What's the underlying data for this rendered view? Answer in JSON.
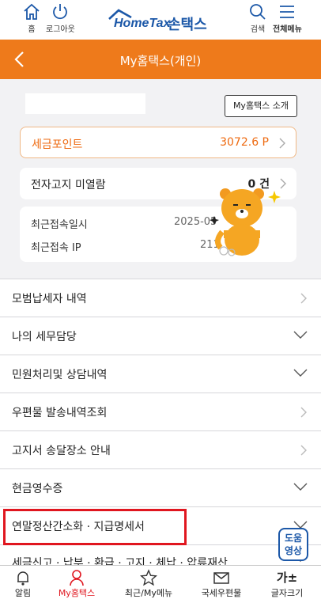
{
  "topbar": {
    "home_label": "홈",
    "logout_label": "로그아웃",
    "logo_text": "HomeTax",
    "logo_korean": "손택스",
    "search_label": "검색",
    "menu_label": "전체메뉴"
  },
  "header": {
    "title": "My홈택스(개인)"
  },
  "profile": {
    "intro_button": "My홈택스 소개",
    "tax_point_label": "세금포인트",
    "tax_point_value": "3072.6 P",
    "notice_label": "전자고지 미열람",
    "notice_value": "0 건",
    "last_login_label": "최근접속일시",
    "last_login_value": "2025-05",
    "last_ip_label": "최근접속 IP",
    "last_ip_value": "211"
  },
  "menu": {
    "items": [
      {
        "label": "모범납세자 내역",
        "chevron": "right"
      },
      {
        "label": "나의 세무담당",
        "chevron": "down"
      },
      {
        "label": "민원처리및 상담내역",
        "chevron": "down"
      },
      {
        "label": "우편물 발송내역조회",
        "chevron": "right"
      },
      {
        "label": "고지서 송달장소 안내",
        "chevron": "right"
      },
      {
        "label": "현금영수증",
        "chevron": "down"
      },
      {
        "label": "연말정산간소화 · 지급명세서",
        "chevron": "down"
      },
      {
        "label": "세금신고 · 납부 · 환급 · 고지 · 체납 · 압류재산",
        "chevron": "down"
      }
    ]
  },
  "help": {
    "line1": "도움",
    "line2": "영상"
  },
  "bottom_nav": {
    "items": [
      {
        "label": "알림",
        "icon": "bell-icon"
      },
      {
        "label": "My홈택스",
        "icon": "person-icon"
      },
      {
        "label": "최근/My메뉴",
        "icon": "star-icon"
      },
      {
        "label": "국세우편물",
        "icon": "mail-icon"
      },
      {
        "label": "글자크기",
        "icon": "font-size-icon",
        "glyph": "가±"
      }
    ]
  },
  "colors": {
    "accent": "#ee7a1b",
    "brand": "#1c58a8",
    "active": "#e0161f"
  }
}
